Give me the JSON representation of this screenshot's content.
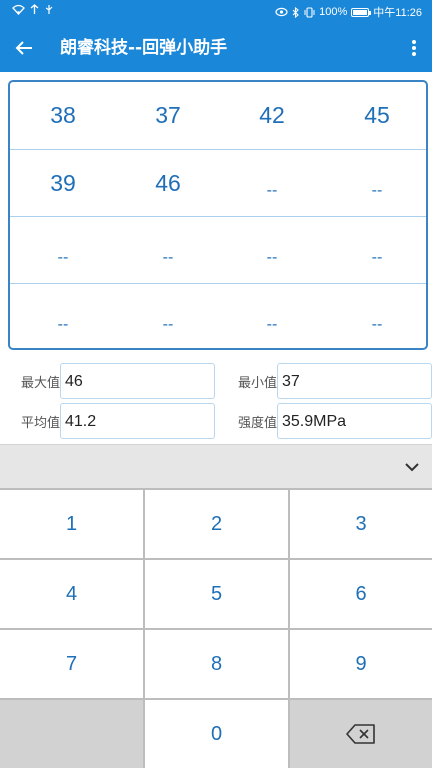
{
  "status_bar": {
    "battery": "100%",
    "time": "中午11:26"
  },
  "app_bar": {
    "title": "朗睿科技--回弹小助手"
  },
  "readings": [
    [
      "38",
      "37",
      "42",
      "45"
    ],
    [
      "39",
      "46",
      "--",
      "--"
    ],
    [
      "--",
      "--",
      "--",
      "--"
    ],
    [
      "--",
      "--",
      "--",
      "--"
    ]
  ],
  "stats": {
    "max_label": "最大值",
    "max_value": "46",
    "min_label": "最小值",
    "min_value": "37",
    "avg_label": "平均值",
    "avg_value": "41.2",
    "strength_label": "强度值",
    "strength_value": "35.9MPa"
  },
  "keypad": {
    "keys": [
      "1",
      "2",
      "3",
      "4",
      "5",
      "6",
      "7",
      "8",
      "9",
      "0"
    ]
  },
  "colors": {
    "accent": "#1a87d8",
    "value_text": "#1f6fb8",
    "grid_border": "#3a84c6"
  }
}
